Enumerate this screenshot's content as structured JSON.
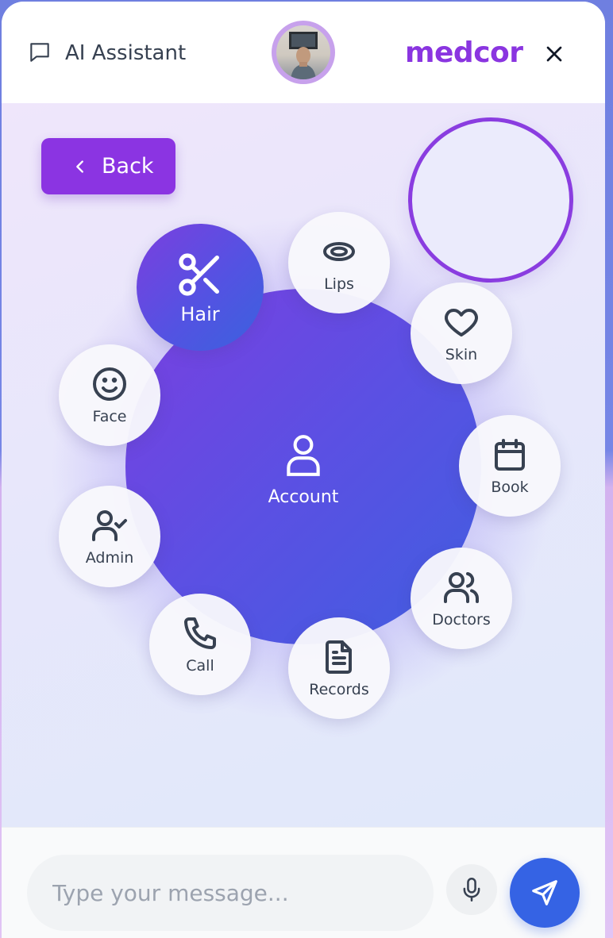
{
  "header": {
    "title": "AI Assistant",
    "brand": "medcor",
    "chat_icon": "chat-bubble-icon",
    "close_icon": "close-icon"
  },
  "back_button": {
    "label": "Back",
    "icon": "chevron-left-icon"
  },
  "center": {
    "label": "Account",
    "icon": "user-icon"
  },
  "menu": {
    "hair": {
      "label": "Hair",
      "icon": "scissors-icon",
      "active": true
    },
    "lips": {
      "label": "Lips",
      "icon": "lips-icon"
    },
    "skin": {
      "label": "Skin",
      "icon": "heart-icon"
    },
    "face": {
      "label": "Face",
      "icon": "smile-icon"
    },
    "book": {
      "label": "Book",
      "icon": "calendar-icon"
    },
    "admin": {
      "label": "Admin",
      "icon": "user-check-icon"
    },
    "doctors": {
      "label": "Doctors",
      "icon": "users-icon"
    },
    "call": {
      "label": "Call",
      "icon": "phone-icon"
    },
    "records": {
      "label": "Records",
      "icon": "document-icon"
    }
  },
  "composer": {
    "placeholder": "Type your message...",
    "value": "",
    "mic_icon": "microphone-icon",
    "send_icon": "send-icon"
  },
  "colors": {
    "brand": "#8a35e0",
    "accent_blue": "#3563e4",
    "accent_purple": "#7a3fe0"
  }
}
